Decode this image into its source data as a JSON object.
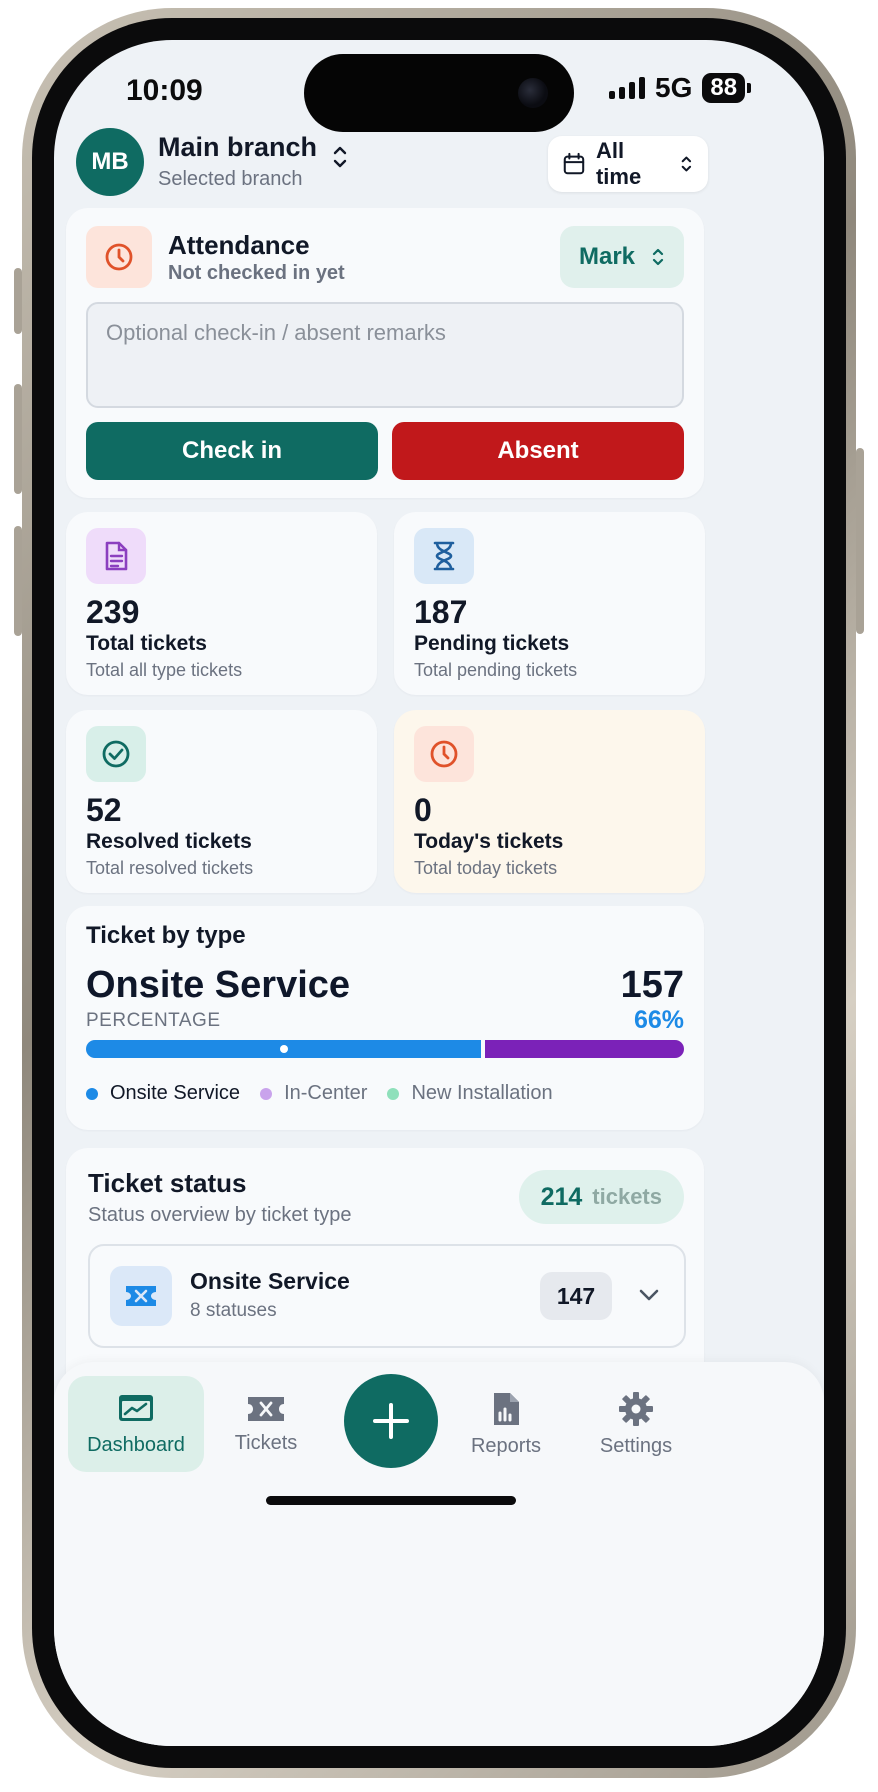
{
  "status_bar": {
    "time": "10:09",
    "network": "5G",
    "battery": "88"
  },
  "header": {
    "avatar_initials": "MB",
    "branch_name": "Main branch",
    "branch_subtitle": "Selected branch",
    "time_filter": "All time"
  },
  "attendance": {
    "title": "Attendance",
    "subtitle": "Not checked in yet",
    "mark_label": "Mark",
    "remarks_placeholder": "Optional check-in / absent remarks",
    "checkin_label": "Check in",
    "absent_label": "Absent"
  },
  "stats": [
    {
      "value": "239",
      "label": "Total tickets",
      "sub": "Total all type tickets",
      "icon": "document-icon",
      "color": "#8b3fbf"
    },
    {
      "value": "187",
      "label": "Pending tickets",
      "sub": "Total pending tickets",
      "icon": "hourglass-icon",
      "color": "#1f5f9e"
    },
    {
      "value": "52",
      "label": "Resolved tickets",
      "sub": "Total resolved tickets",
      "icon": "check-circle-icon",
      "color": "#0f6b62"
    },
    {
      "value": "0",
      "label": "Today's tickets",
      "sub": "Total today tickets",
      "icon": "clock-icon",
      "color": "#e0522a"
    }
  ],
  "ticket_by_type": {
    "heading": "Ticket by type",
    "selected_name": "Onsite Service",
    "selected_count": "157",
    "percentage_label": "PERCENTAGE",
    "selected_percent": "66%",
    "segments": [
      {
        "name": "Onsite Service",
        "share": 0.665,
        "color": "#1d8ae6"
      },
      {
        "name": "In-Center",
        "share": 0.335,
        "color": "#7b22b8"
      },
      {
        "name": "New Installation",
        "share": 0,
        "color": "#6fd6a6"
      }
    ],
    "legend": [
      {
        "name": "Onsite Service",
        "color": "#1d8ae6",
        "active": true
      },
      {
        "name": "In-Center",
        "color": "#c9a3ec",
        "active": false
      },
      {
        "name": "New Installation",
        "color": "#8fe0bb",
        "active": false
      }
    ]
  },
  "ticket_status": {
    "title": "Ticket status",
    "subtitle": "Status overview by ticket type",
    "total": "214",
    "total_unit": "tickets",
    "rows": [
      {
        "name": "Onsite Service",
        "sub": "8 statuses",
        "count": "147",
        "icon": "ticket-icon"
      }
    ]
  },
  "tabbar": {
    "items": [
      {
        "label": "Dashboard",
        "icon": "dashboard-icon",
        "active": true
      },
      {
        "label": "Tickets",
        "icon": "ticket-icon",
        "active": false
      },
      {
        "label": "Reports",
        "icon": "report-icon",
        "active": false
      },
      {
        "label": "Settings",
        "icon": "gear-icon",
        "active": false
      }
    ],
    "fab_icon": "plus-icon"
  },
  "colors": {
    "primary": "#0f6b62",
    "danger": "#c1181b",
    "accent_blue": "#1d8ae6",
    "accent_purple": "#7b22b8"
  }
}
